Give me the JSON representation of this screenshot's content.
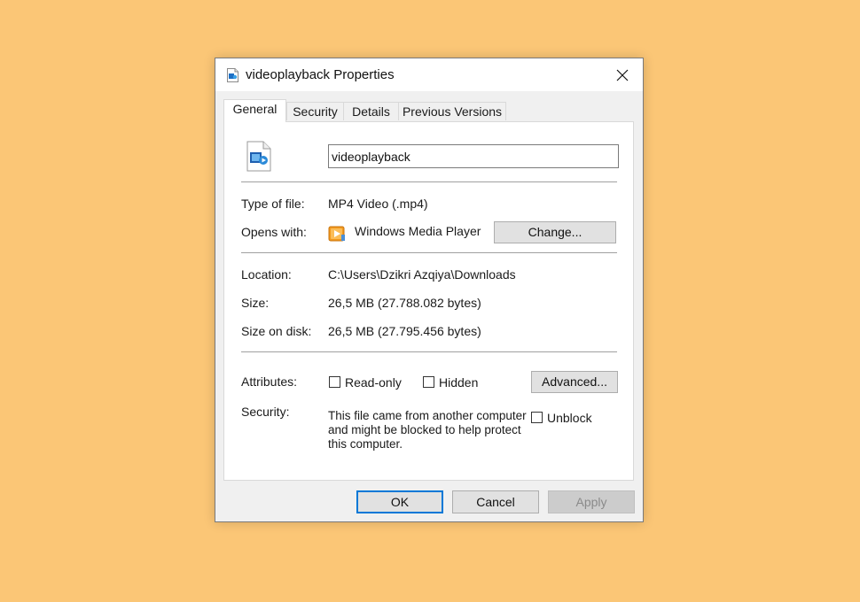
{
  "window": {
    "title": "videoplayback Properties",
    "close_glyph": "✕"
  },
  "tabs": [
    {
      "label": "General",
      "active": true
    },
    {
      "label": "Security",
      "active": false
    },
    {
      "label": "Details",
      "active": false
    },
    {
      "label": "Previous Versions",
      "active": false
    }
  ],
  "general": {
    "file_name": "videoplayback",
    "type_label": "Type of file:",
    "type_value": "MP4 Video (.mp4)",
    "opens_label": "Opens with:",
    "opens_value": "Windows Media Player",
    "change_button": "Change...",
    "location_label": "Location:",
    "location_value": "C:\\Users\\Dzikri Azqiya\\Downloads",
    "size_label": "Size:",
    "size_value": "26,5 MB (27.788.082 bytes)",
    "size_disk_label": "Size on disk:",
    "size_disk_value": "26,5 MB (27.795.456 bytes)",
    "attributes_label": "Attributes:",
    "readonly_label": "Read-only",
    "readonly_checked": false,
    "hidden_label": "Hidden",
    "hidden_checked": false,
    "advanced_button": "Advanced...",
    "security_label": "Security:",
    "security_text": "This file came from another computer and might be blocked to help protect this computer.",
    "unblock_label": "Unblock",
    "unblock_checked": false
  },
  "footer": {
    "ok": "OK",
    "cancel": "Cancel",
    "apply": "Apply"
  },
  "colors": {
    "desktop": "#fbc676",
    "accent": "#0078d7",
    "wmp_orange": "#f39a1e"
  },
  "icons": {
    "title": "video-file-icon",
    "file": "video-file-icon",
    "opens_with": "windows-media-player-icon",
    "close": "close-icon"
  }
}
